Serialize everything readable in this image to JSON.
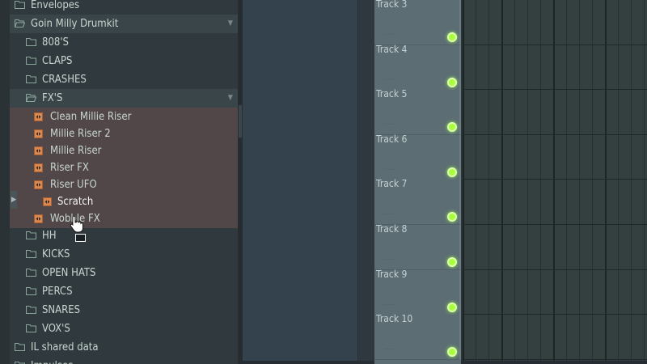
{
  "browser": {
    "items": [
      {
        "label": "Envelopes",
        "level": 0,
        "icon": "folder-icon"
      },
      {
        "label": "Goin Milly Drumkit",
        "level": 0,
        "icon": "folder-open-icon",
        "expanded": true
      },
      {
        "label": "808'S",
        "level": 1,
        "icon": "folder-icon"
      },
      {
        "label": "CLAPS",
        "level": 1,
        "icon": "folder-icon"
      },
      {
        "label": "CRASHES",
        "level": 1,
        "icon": "folder-icon"
      },
      {
        "label": "FX'S",
        "level": 1,
        "icon": "folder-open-icon",
        "expanded": true
      },
      {
        "label": "Clean Millie Riser",
        "level": 2,
        "icon": "audio-file-icon"
      },
      {
        "label": "Millie Riser 2",
        "level": 2,
        "icon": "audio-file-icon"
      },
      {
        "label": "Millie Riser",
        "level": 2,
        "icon": "audio-file-icon"
      },
      {
        "label": "Riser FX",
        "level": 2,
        "icon": "audio-file-icon"
      },
      {
        "label": "Riser UFO",
        "level": 2,
        "icon": "audio-file-icon"
      },
      {
        "label": "Scratch",
        "level": 2,
        "icon": "audio-file-icon",
        "dragging": true
      },
      {
        "label": "Wobble FX",
        "level": 2,
        "icon": "audio-file-icon"
      },
      {
        "label": "HH",
        "level": 1,
        "icon": "folder-icon"
      },
      {
        "label": "KICKS",
        "level": 1,
        "icon": "folder-icon"
      },
      {
        "label": "OPEN HATS",
        "level": 1,
        "icon": "folder-icon"
      },
      {
        "label": "PERCS",
        "level": 1,
        "icon": "folder-icon"
      },
      {
        "label": "SNARES",
        "level": 1,
        "icon": "folder-icon"
      },
      {
        "label": "VOX'S",
        "level": 1,
        "icon": "folder-icon"
      },
      {
        "label": "IL shared data",
        "level": 0,
        "icon": "folder-icon"
      },
      {
        "label": "Impulses",
        "level": 0,
        "icon": "folder-icon"
      }
    ]
  },
  "tracks": [
    {
      "name": "Track 3",
      "led": "#a8ff3c"
    },
    {
      "name": "Track 4",
      "led": "#a8ff3c"
    },
    {
      "name": "Track 5",
      "led": "#a8ff3c"
    },
    {
      "name": "Track 6",
      "led": "#a8ff3c"
    },
    {
      "name": "Track 7",
      "led": "#a8ff3c"
    },
    {
      "name": "Track 8",
      "led": "#a8ff3c"
    },
    {
      "name": "Track 9",
      "led": "#a8ff3c"
    },
    {
      "name": "Track 10",
      "led": "#a8ff3c"
    }
  ],
  "colors": {
    "folder": "#8aa59a",
    "audio_file": "#d98a52",
    "selected_row": "#514748",
    "led": "#a8ff3c"
  }
}
